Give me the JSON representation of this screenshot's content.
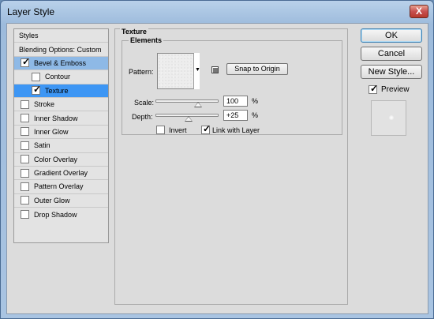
{
  "window": {
    "title": "Layer Style",
    "close_glyph": "X"
  },
  "styles_list": {
    "header": "Styles",
    "blending": "Blending Options: Custom",
    "items": [
      {
        "label": "Bevel & Emboss",
        "checked": true
      },
      {
        "label": "Contour",
        "checked": false
      },
      {
        "label": "Texture",
        "checked": true
      },
      {
        "label": "Stroke",
        "checked": false
      },
      {
        "label": "Inner Shadow",
        "checked": false
      },
      {
        "label": "Inner Glow",
        "checked": false
      },
      {
        "label": "Satin",
        "checked": false
      },
      {
        "label": "Color Overlay",
        "checked": false
      },
      {
        "label": "Gradient Overlay",
        "checked": false
      },
      {
        "label": "Pattern Overlay",
        "checked": false
      },
      {
        "label": "Outer Glow",
        "checked": false
      },
      {
        "label": "Drop Shadow",
        "checked": false
      }
    ]
  },
  "texture_panel": {
    "group_title": "Texture",
    "elements_title": "Elements",
    "pattern_label": "Pattern:",
    "snap_button": "Snap to Origin",
    "scale_label": "Scale:",
    "scale_value": "100",
    "scale_unit": "%",
    "scale_level": 100,
    "depth_label": "Depth:",
    "depth_value": "+25",
    "depth_unit": "%",
    "depth_level": 25,
    "invert_label": "Invert",
    "invert_checked": false,
    "link_label": "Link with Layer",
    "link_checked": true
  },
  "actions": {
    "ok": "OK",
    "cancel": "Cancel",
    "new_style": "New Style...",
    "preview_label": "Preview",
    "preview_checked": true
  },
  "colors": {
    "selected_row": "#3d96f4",
    "parent_row": "#8eb9e6",
    "dialog_bg": "#dcdcdc"
  }
}
